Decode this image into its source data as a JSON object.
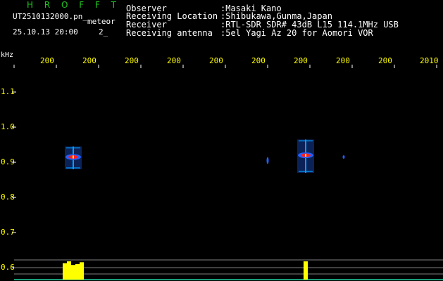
{
  "header": {
    "brand": "H R O F F T",
    "brand_color": "#21c821",
    "file_name": "UT2510132000.pn_",
    "mode_label": "meteor",
    "datetime": "25.10.13 20:00",
    "count": "2_"
  },
  "info": {
    "rows": [
      {
        "label": "Observer",
        "value": ":Masaki Kano"
      },
      {
        "label": "Receiving Location",
        "value": ":Shibukawa,Gunma,Japan"
      },
      {
        "label": "Receiver",
        "value": ":RTL-SDR SDR# 43dB L15 114.1MHz USB"
      },
      {
        "label": "Receiving antenna",
        "value": ":5el Yagi Az 20 for Aomori VOR"
      }
    ]
  },
  "axis": {
    "y_unit": "kHz",
    "x_ticks": [
      "200",
      "200",
      "200",
      "200",
      "200",
      "200",
      "200",
      "200",
      "200",
      "2010"
    ],
    "y_ticks": [
      "1.1",
      "1.0",
      "0.9",
      "0.8",
      "0.7",
      "0.6"
    ],
    "tick_color": "#ffff00"
  },
  "colors": {
    "echo_core": "#ff2020",
    "echo_mid": "#2060ff",
    "echo_edge": "#00a0ff",
    "echo_hot": "#ffff40",
    "activity": "#ffff00",
    "baseline": "#20d0a0",
    "grid": "#808080"
  },
  "chart_data": {
    "type": "heatmap",
    "y_label": "kHz",
    "ylim": [
      0.6,
      1.1
    ],
    "echoes": [
      {
        "x_minute": 1.4,
        "freq_center": 0.915,
        "freq_low": 0.88,
        "freq_high": 0.945,
        "intensity": "strong"
      },
      {
        "x_minute": 6.0,
        "freq_center": 0.905,
        "freq_low": 0.895,
        "freq_high": 0.915,
        "intensity": "faint"
      },
      {
        "x_minute": 6.9,
        "freq_center": 0.92,
        "freq_low": 0.87,
        "freq_high": 0.965,
        "intensity": "strong"
      },
      {
        "x_minute": 7.8,
        "freq_center": 0.915,
        "freq_low": 0.91,
        "freq_high": 0.92,
        "intensity": "faint"
      }
    ],
    "activity_bars": [
      {
        "x_minute": 1.2,
        "level": 0.9
      },
      {
        "x_minute": 1.3,
        "level": 1.0
      },
      {
        "x_minute": 1.4,
        "level": 0.8
      },
      {
        "x_minute": 1.5,
        "level": 0.85
      },
      {
        "x_minute": 1.6,
        "level": 0.95
      },
      {
        "x_minute": 6.9,
        "level": 1.0
      }
    ]
  }
}
